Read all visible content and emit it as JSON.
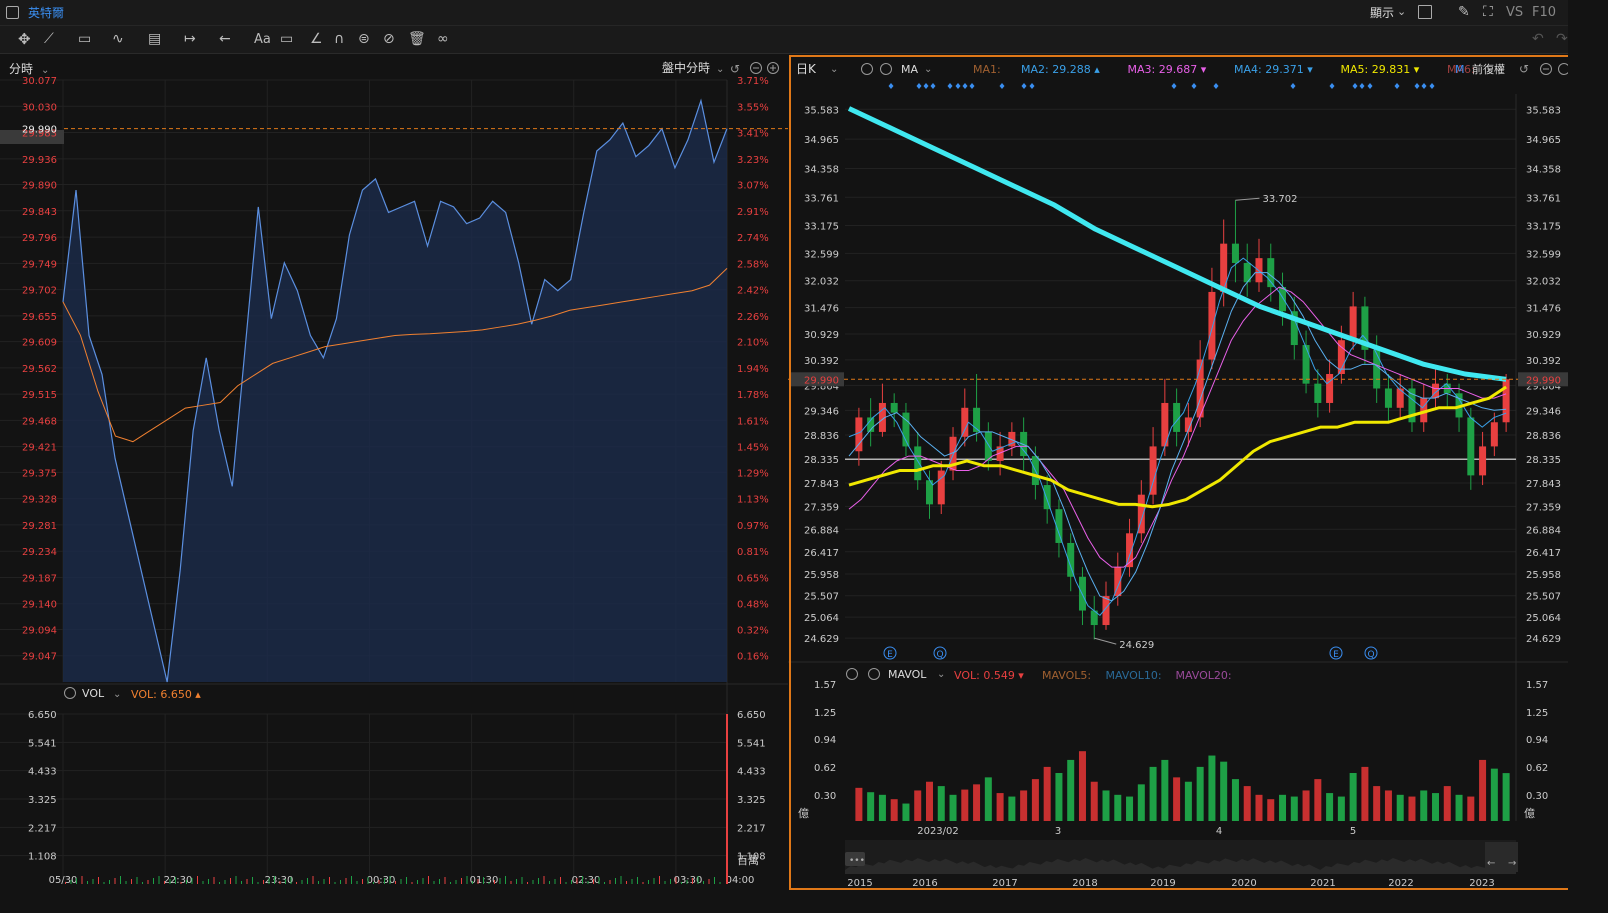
{
  "app": {
    "stock_name": "英特爾",
    "display_label": "顯示",
    "vs_label": "VS",
    "f10_label": "F10"
  },
  "toolbar": {
    "text_tool_label": "Aa"
  },
  "left": {
    "period_label": "分時",
    "session_label": "盤中分時",
    "vol_label": "VOL",
    "vol_value": "VOL: 6.650 ▴",
    "vol_unit": "百萬"
  },
  "right": {
    "period_label": "日K",
    "indicator_label": "MA",
    "fq_label": "前復權",
    "vol_indicator_label": "MAVOL",
    "vol_value": "VOL: 0.549 ▾",
    "vol_unit": "億",
    "ma_legend": [
      {
        "text": "MA1:",
        "color": "#a06030"
      },
      {
        "text": "MA2: 29.288 ▴",
        "color": "#3aa0e8"
      },
      {
        "text": "MA3: 29.687 ▾",
        "color": "#e860e8"
      },
      {
        "text": "MA4: 29.371 ▾",
        "color": "#3aa0e8"
      },
      {
        "text": "MA5: 29.831 ▾",
        "color": "#f0e800"
      },
      {
        "text": "MA6:",
        "color": "#a04040"
      }
    ],
    "mavol_legend": [
      {
        "text": "MAVOL5:",
        "color": "#a06030"
      },
      {
        "text": "MAVOL10:",
        "color": "#2a6a98"
      },
      {
        "text": "MAVOL20:",
        "color": "#9a4a9a"
      }
    ],
    "event_markers": [
      "E",
      "Q",
      "E",
      "Q"
    ]
  },
  "colors": {
    "up": "#e84040",
    "down": "#1ea046",
    "price_line": "#5b8fe0",
    "avg_line": "#f08030",
    "ma_thick": "#40e8f0",
    "ma_yellow": "#f0e800",
    "accent": "#e07818"
  },
  "chart_data": [
    {
      "type": "line",
      "title": "分時",
      "price_axis": [
        "30.077",
        "30.030",
        "29.983",
        "29.936",
        "29.890",
        "29.843",
        "29.796",
        "29.749",
        "29.702",
        "29.655",
        "29.609",
        "29.562",
        "29.515",
        "29.468",
        "29.421",
        "29.375",
        "29.328",
        "29.281",
        "29.234",
        "29.187",
        "29.140",
        "29.094",
        "29.047"
      ],
      "pct_axis": [
        "3.71%",
        "3.55%",
        "3.41%",
        "3.23%",
        "3.07%",
        "2.91%",
        "2.74%",
        "2.58%",
        "2.42%",
        "2.26%",
        "2.10%",
        "1.94%",
        "1.78%",
        "1.61%",
        "1.45%",
        "1.29%",
        "1.13%",
        "0.97%",
        "0.81%",
        "0.65%",
        "0.48%",
        "0.32%",
        "0.16%"
      ],
      "ylim": [
        29.0,
        30.077
      ],
      "current_price": "29.990",
      "current_pct": "3.41%",
      "x_labels": [
        "05/30",
        "22:30",
        "23:30",
        "00:30",
        "01:30",
        "02:30",
        "03:30",
        "04:00"
      ],
      "series": [
        {
          "name": "price",
          "values": [
            29.68,
            29.88,
            29.62,
            29.55,
            29.4,
            29.3,
            29.2,
            29.1,
            29.0,
            29.2,
            29.45,
            29.58,
            29.45,
            29.35,
            29.6,
            29.85,
            29.65,
            29.75,
            29.7,
            29.62,
            29.58,
            29.65,
            29.8,
            29.88,
            29.9,
            29.84,
            29.85,
            29.86,
            29.78,
            29.86,
            29.85,
            29.82,
            29.83,
            29.86,
            29.84,
            29.75,
            29.64,
            29.72,
            29.7,
            29.72,
            29.84,
            29.95,
            29.97,
            30.0,
            29.94,
            29.96,
            29.99,
            29.92,
            29.97,
            30.04,
            29.93,
            29.99
          ]
        },
        {
          "name": "avg",
          "values": [
            29.68,
            29.62,
            29.52,
            29.44,
            29.43,
            29.45,
            29.47,
            29.49,
            29.495,
            29.5,
            29.53,
            29.55,
            29.57,
            29.58,
            29.59,
            29.6,
            29.605,
            29.61,
            29.615,
            29.62,
            29.622,
            29.623,
            29.625,
            29.627,
            29.63,
            29.635,
            29.64,
            29.647,
            29.655,
            29.665,
            29.67,
            29.675,
            29.68,
            29.685,
            29.69,
            29.695,
            29.7,
            29.71,
            29.74
          ]
        }
      ],
      "volume": {
        "axis": [
          "6.650",
          "5.541",
          "4.433",
          "3.325",
          "2.217",
          "1.108"
        ],
        "ylim": [
          0,
          6.65
        ],
        "last": 6.65,
        "unit": "百萬"
      }
    },
    {
      "type": "candlestick",
      "title": "日K",
      "price_axis": [
        "35.583",
        "34.965",
        "34.358",
        "33.761",
        "33.175",
        "32.599",
        "32.032",
        "31.476",
        "30.929",
        "30.392",
        "29.864",
        "29.346",
        "28.836",
        "28.335",
        "27.843",
        "27.359",
        "26.884",
        "26.417",
        "25.958",
        "25.507",
        "25.064",
        "24.629"
      ],
      "ylim": [
        24.3,
        35.9
      ],
      "current_price": "29.990",
      "support_line": 28.335,
      "high_label": "33.702",
      "low_label": "24.629",
      "x_labels": [
        "2023/02",
        "3",
        "4",
        "5"
      ],
      "overview_years": [
        "2015",
        "2016",
        "2017",
        "2018",
        "2019",
        "2020",
        "2021",
        "2022",
        "2023"
      ],
      "candles": [
        [
          28.5,
          29.2,
          28.2,
          29.4
        ],
        [
          29.2,
          28.9,
          28.6,
          29.6
        ],
        [
          28.9,
          29.5,
          28.8,
          29.9
        ],
        [
          29.5,
          29.3,
          29.0,
          29.7
        ],
        [
          29.3,
          28.6,
          28.4,
          29.5
        ],
        [
          28.6,
          27.9,
          27.7,
          28.9
        ],
        [
          27.9,
          27.4,
          27.1,
          28.1
        ],
        [
          27.4,
          28.1,
          27.2,
          28.3
        ],
        [
          28.1,
          28.8,
          27.9,
          29.0
        ],
        [
          28.8,
          29.4,
          28.6,
          29.8
        ],
        [
          29.4,
          28.9,
          28.7,
          30.1
        ],
        [
          28.9,
          28.3,
          28.1,
          29.1
        ],
        [
          28.3,
          28.6,
          28.0,
          28.9
        ],
        [
          28.6,
          28.9,
          28.4,
          29.1
        ],
        [
          28.9,
          28.4,
          28.1,
          29.2
        ],
        [
          28.4,
          27.8,
          27.5,
          28.6
        ],
        [
          27.8,
          27.3,
          27.0,
          28.0
        ],
        [
          27.3,
          26.6,
          26.3,
          27.5
        ],
        [
          26.6,
          25.9,
          25.6,
          26.8
        ],
        [
          25.9,
          25.2,
          24.9,
          26.1
        ],
        [
          25.2,
          24.9,
          24.6,
          25.5
        ],
        [
          24.9,
          25.5,
          24.8,
          25.8
        ],
        [
          25.5,
          26.1,
          25.3,
          26.4
        ],
        [
          26.1,
          26.8,
          25.9,
          27.1
        ],
        [
          26.8,
          27.6,
          26.6,
          27.9
        ],
        [
          27.6,
          28.6,
          27.4,
          29.0
        ],
        [
          28.6,
          29.5,
          28.4,
          30.0
        ],
        [
          29.5,
          28.9,
          28.6,
          29.8
        ],
        [
          28.9,
          29.2,
          28.6,
          29.5
        ],
        [
          29.2,
          30.4,
          29.0,
          30.8
        ],
        [
          30.4,
          31.8,
          30.2,
          32.3
        ],
        [
          31.8,
          32.8,
          31.5,
          33.3
        ],
        [
          32.8,
          32.4,
          32.0,
          33.7
        ],
        [
          32.4,
          32.0,
          31.7,
          32.8
        ],
        [
          32.0,
          32.5,
          31.8,
          32.9
        ],
        [
          32.5,
          31.9,
          31.6,
          32.8
        ],
        [
          31.9,
          31.4,
          31.1,
          32.2
        ],
        [
          31.4,
          30.7,
          30.4,
          31.7
        ],
        [
          30.7,
          29.9,
          29.7,
          31.0
        ],
        [
          29.9,
          29.5,
          29.2,
          30.2
        ],
        [
          29.5,
          30.1,
          29.3,
          30.4
        ],
        [
          30.1,
          30.8,
          29.9,
          31.1
        ],
        [
          30.8,
          31.5,
          30.6,
          31.8
        ],
        [
          31.5,
          30.6,
          30.3,
          31.7
        ],
        [
          30.6,
          29.8,
          29.5,
          30.9
        ],
        [
          29.8,
          29.4,
          29.1,
          30.1
        ],
        [
          29.4,
          29.8,
          29.2,
          30.1
        ],
        [
          29.8,
          29.1,
          28.9,
          30.0
        ],
        [
          29.1,
          29.6,
          28.9,
          29.9
        ],
        [
          29.6,
          29.9,
          29.4,
          30.2
        ],
        [
          29.9,
          29.7,
          29.4,
          30.1
        ],
        [
          29.7,
          29.2,
          28.9,
          29.9
        ],
        [
          29.2,
          28.0,
          27.7,
          29.4
        ],
        [
          28.0,
          28.6,
          27.8,
          28.9
        ],
        [
          28.6,
          29.1,
          28.4,
          29.3
        ],
        [
          29.1,
          29.99,
          28.9,
          30.1
        ]
      ],
      "volume": {
        "axis": [
          "1.57",
          "1.25",
          "0.94",
          "0.62",
          "0.30"
        ],
        "ylim": [
          0,
          1.57
        ],
        "unit": "億",
        "bars": [
          [
            0.38,
            0
          ],
          [
            0.33,
            1
          ],
          [
            0.3,
            1
          ],
          [
            0.25,
            0
          ],
          [
            0.2,
            1
          ],
          [
            0.35,
            0
          ],
          [
            0.45,
            0
          ],
          [
            0.4,
            1
          ],
          [
            0.3,
            1
          ],
          [
            0.36,
            0
          ],
          [
            0.42,
            0
          ],
          [
            0.5,
            1
          ],
          [
            0.32,
            0
          ],
          [
            0.28,
            1
          ],
          [
            0.35,
            0
          ],
          [
            0.48,
            0
          ],
          [
            0.62,
            0
          ],
          [
            0.55,
            1
          ],
          [
            0.7,
            1
          ],
          [
            0.8,
            0
          ],
          [
            0.45,
            0
          ],
          [
            0.35,
            1
          ],
          [
            0.3,
            1
          ],
          [
            0.28,
            1
          ],
          [
            0.42,
            1
          ],
          [
            0.62,
            1
          ],
          [
            0.7,
            1
          ],
          [
            0.5,
            0
          ],
          [
            0.45,
            1
          ],
          [
            0.62,
            1
          ],
          [
            0.75,
            1
          ],
          [
            0.68,
            1
          ],
          [
            0.48,
            1
          ],
          [
            0.4,
            0
          ],
          [
            0.3,
            0
          ],
          [
            0.25,
            0
          ],
          [
            0.3,
            1
          ],
          [
            0.28,
            1
          ],
          [
            0.35,
            0
          ],
          [
            0.48,
            0
          ],
          [
            0.32,
            1
          ],
          [
            0.28,
            1
          ],
          [
            0.55,
            1
          ],
          [
            0.62,
            0
          ],
          [
            0.4,
            0
          ],
          [
            0.35,
            0
          ],
          [
            0.3,
            1
          ],
          [
            0.28,
            0
          ],
          [
            0.35,
            1
          ],
          [
            0.32,
            1
          ],
          [
            0.4,
            0
          ],
          [
            0.3,
            1
          ],
          [
            0.28,
            0
          ],
          [
            0.7,
            0
          ],
          [
            0.6,
            1
          ],
          [
            0.549,
            1
          ]
        ]
      },
      "moving_averages": [
        {
          "name": "MA2",
          "values": [
            28.8,
            28.9,
            29.2,
            29.4,
            29.1,
            28.6,
            28.2,
            27.8,
            28.0,
            28.6,
            29.1,
            28.9,
            28.5,
            28.6,
            28.7,
            28.4,
            27.9,
            27.2,
            26.5,
            25.8,
            25.3,
            25.1,
            25.4,
            26.0,
            26.7,
            27.5,
            28.3,
            29.0,
            29.3,
            29.9,
            30.7,
            31.6,
            32.3,
            32.5,
            32.3,
            32.1,
            31.8,
            31.4,
            30.8,
            30.2,
            29.9,
            30.1,
            30.6,
            30.9,
            30.6,
            30.1,
            29.8,
            29.6,
            29.4,
            29.7,
            29.9,
            29.6,
            29.2,
            29.0,
            29.2,
            29.29
          ]
        },
        {
          "name": "MA3",
          "values": [
            27.3,
            27.5,
            27.8,
            28.1,
            28.3,
            28.4,
            28.4,
            28.3,
            28.2,
            28.1,
            28.1,
            28.2,
            28.4,
            28.5,
            28.6,
            28.6,
            28.3,
            28.0,
            27.7,
            27.2,
            26.7,
            26.3,
            26.1,
            26.1,
            26.3,
            26.8,
            27.3,
            27.9,
            28.4,
            29.0,
            29.6,
            30.2,
            30.8,
            31.2,
            31.5,
            31.7,
            31.9,
            31.8,
            31.6,
            31.3,
            31.0,
            30.7,
            30.5,
            30.4,
            30.3,
            30.2,
            30.1,
            30.0,
            29.9,
            29.8,
            29.8,
            29.8,
            29.7,
            29.6,
            29.6,
            29.69
          ]
        },
        {
          "name": "MA4",
          "values": [
            28.4,
            28.7,
            29.0,
            29.2,
            29.3,
            29.1,
            28.8,
            28.6,
            28.4,
            28.5,
            28.8,
            28.9,
            28.9,
            28.8,
            28.7,
            28.6,
            28.3,
            27.9,
            27.3,
            26.6,
            26.0,
            25.5,
            25.4,
            25.6,
            26.0,
            26.6,
            27.3,
            28.1,
            28.7,
            29.3,
            30.0,
            30.7,
            31.4,
            31.9,
            32.2,
            32.2,
            32.0,
            31.7,
            31.3,
            30.8,
            30.4,
            30.2,
            30.2,
            30.3,
            30.3,
            30.1,
            29.9,
            29.7,
            29.6,
            29.6,
            29.7,
            29.6,
            29.5,
            29.4,
            29.35,
            29.37
          ]
        },
        {
          "name": "MA5",
          "values": [
            27.8,
            27.9,
            28.0,
            28.1,
            28.1,
            28.2,
            28.2,
            28.3,
            28.2,
            28.2,
            28.1,
            28.0,
            27.9,
            27.7,
            27.6,
            27.5,
            27.4,
            27.4,
            27.35,
            27.4,
            27.5,
            27.7,
            27.9,
            28.2,
            28.5,
            28.7,
            28.8,
            28.9,
            29.0,
            29.0,
            29.1,
            29.1,
            29.1,
            29.2,
            29.3,
            29.4,
            29.4,
            29.5,
            29.6,
            29.83
          ]
        },
        {
          "name": "MA-long",
          "values": [
            35.6,
            35.2,
            34.8,
            34.4,
            34.0,
            33.6,
            33.1,
            32.7,
            32.3,
            31.9,
            31.5,
            31.2,
            30.9,
            30.6,
            30.3,
            30.1,
            29.99
          ]
        }
      ]
    }
  ]
}
